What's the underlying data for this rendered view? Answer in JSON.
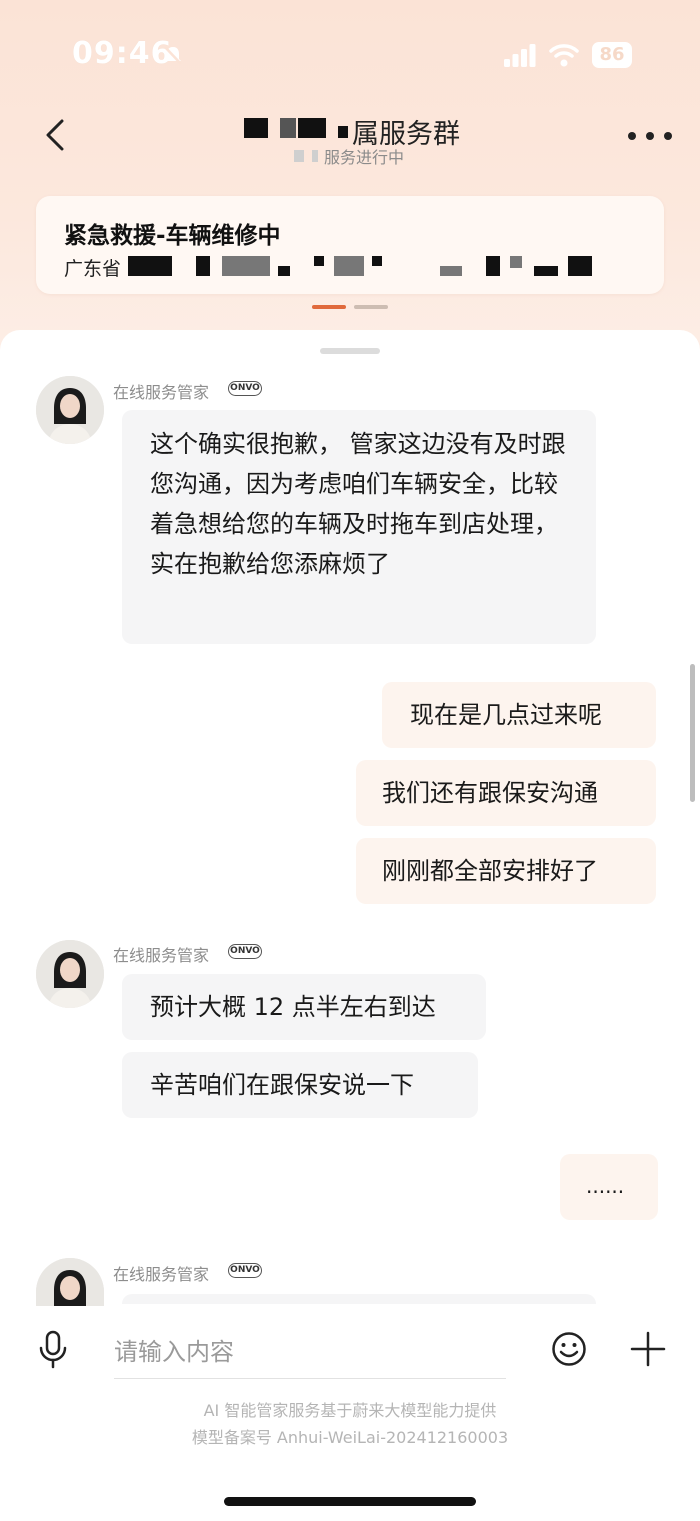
{
  "status_bar": {
    "time": "09:46",
    "battery": "86"
  },
  "header": {
    "title_visible": "属服务群",
    "subtitle_visible": "服务进行中"
  },
  "card": {
    "title": "紧急救援-车辆维修中",
    "address_prefix": "广东省"
  },
  "messages": [
    {
      "from": "agent",
      "sender": "在线服务管家",
      "badge": "ONVO",
      "bubbles": [
        "这个确实很抱歉， 管家这边没有及时跟您沟通，因为考虑咱们车辆安全，比较着急想给您的车辆及时拖车到店处理，实在抱歉给您添麻烦了"
      ]
    },
    {
      "from": "user",
      "bubbles": [
        "现在是几点过来呢",
        "我们还有跟保安沟通",
        "刚刚都全部安排好了"
      ]
    },
    {
      "from": "agent",
      "sender": "在线服务管家",
      "badge": "ONVO",
      "bubbles": [
        "预计大概 12 点半左右到达",
        "辛苦咱们在跟保安说一下"
      ]
    },
    {
      "from": "user",
      "bubbles": [
        "......"
      ]
    },
    {
      "from": "agent",
      "sender": "在线服务管家",
      "badge": "ONVO",
      "bubbles": []
    }
  ],
  "input": {
    "placeholder": "请输入内容"
  },
  "footer": {
    "line1": "AI 智能管家服务基于蔚来大模型能力提供",
    "line2": "模型备案号 Anhui-WeiLai-202412160003"
  },
  "icons": {
    "back": "chevron-left-icon",
    "more": "more-icon",
    "mic": "mic-icon",
    "emoji": "emoji-icon",
    "plus": "plus-icon"
  },
  "colors": {
    "accent": "#e06a3c",
    "header_bg": "#fbe3d6",
    "agent_bubble": "#f5f5f6",
    "user_bubble": "#fdf4ee"
  }
}
